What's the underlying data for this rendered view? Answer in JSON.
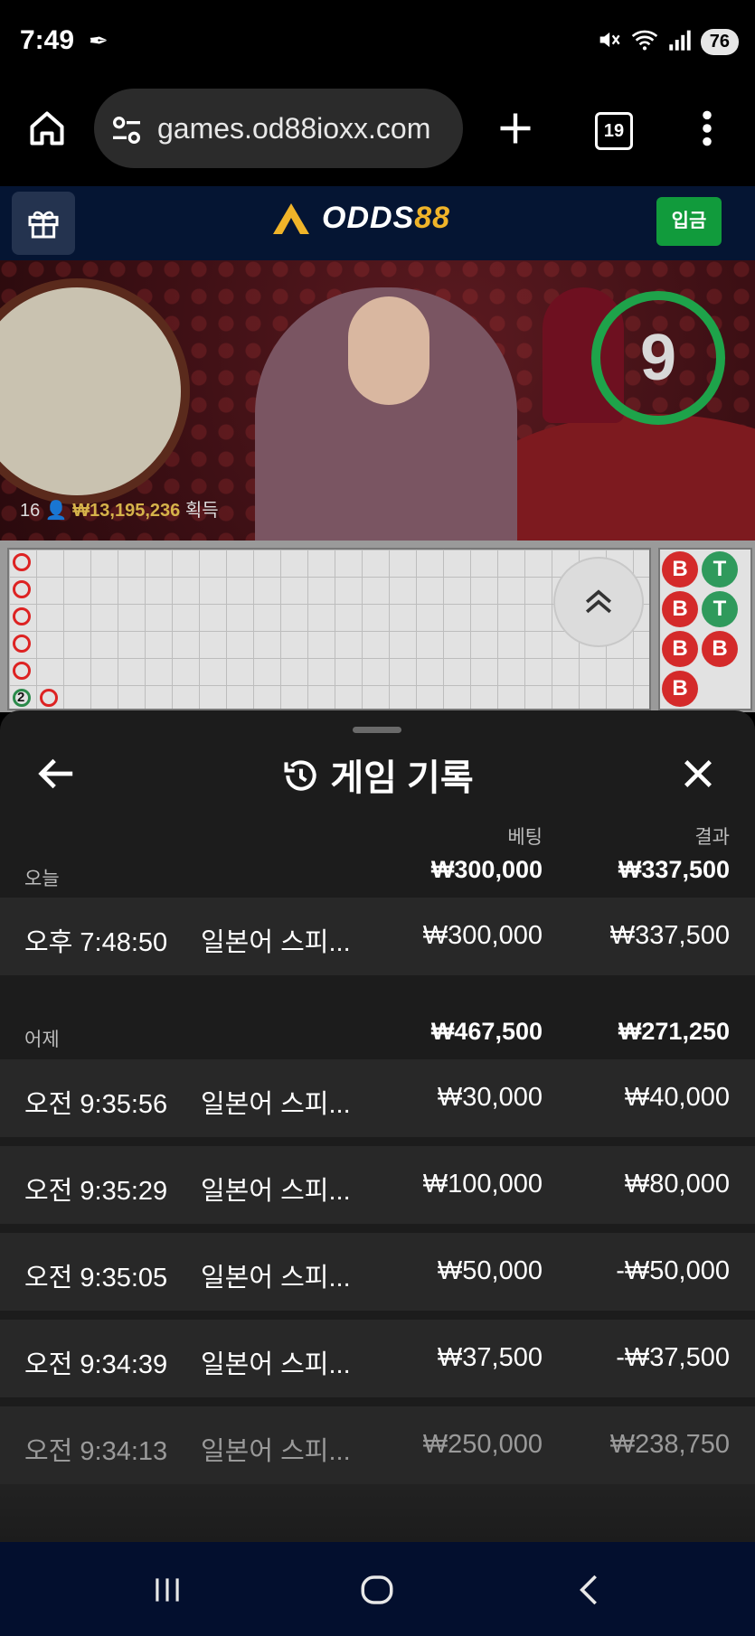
{
  "status_bar": {
    "time": "7:49",
    "battery": "76"
  },
  "browser": {
    "url": "games.od88ioxx.com",
    "tab_count": "19"
  },
  "site": {
    "logo_prefix": "ODDS",
    "logo_suffix": "88",
    "deposit_label": "입금"
  },
  "video": {
    "countdown": "9",
    "player_count": "16",
    "winnings": "₩13,195,236",
    "winnings_suffix": "획득"
  },
  "roadmap": {
    "bead_road": [
      {
        "letter": "B",
        "type": "banker"
      },
      {
        "letter": "T",
        "type": "tie"
      },
      {
        "letter": "B",
        "type": "banker"
      },
      {
        "letter": "T",
        "type": "tie"
      },
      {
        "letter": "B",
        "type": "banker"
      },
      {
        "letter": "B",
        "type": "banker"
      },
      {
        "letter": "B",
        "type": "banker"
      }
    ],
    "tie_count_marker": "2"
  },
  "history": {
    "title": "게임 기록",
    "col_bet": "베팅",
    "col_result": "결과",
    "groups": [
      {
        "label": "오늘",
        "total_bet": "₩300,000",
        "total_result": "₩337,500",
        "rows": [
          {
            "time": "오후 7:48:50",
            "game": "일본어 스피...",
            "bet": "₩300,000",
            "result": "₩337,500"
          }
        ]
      },
      {
        "label": "어제",
        "total_bet": "₩467,500",
        "total_result": "₩271,250",
        "rows": [
          {
            "time": "오전 9:35:56",
            "game": "일본어 스피...",
            "bet": "₩30,000",
            "result": "₩40,000"
          },
          {
            "time": "오전 9:35:29",
            "game": "일본어 스피...",
            "bet": "₩100,000",
            "result": "₩80,000"
          },
          {
            "time": "오전 9:35:05",
            "game": "일본어 스피...",
            "bet": "₩50,000",
            "result": "-₩50,000"
          },
          {
            "time": "오전 9:34:39",
            "game": "일본어 스피...",
            "bet": "₩37,500",
            "result": "-₩37,500"
          },
          {
            "time": "오전 9:34:13",
            "game": "일본어 스피...",
            "bet": "₩250,000",
            "result": "₩238,750"
          }
        ]
      }
    ]
  },
  "colors": {
    "banker": "#d42a2a",
    "tie": "#2f9a5c",
    "deposit": "#119b3c",
    "timer": "#1ea34a"
  }
}
